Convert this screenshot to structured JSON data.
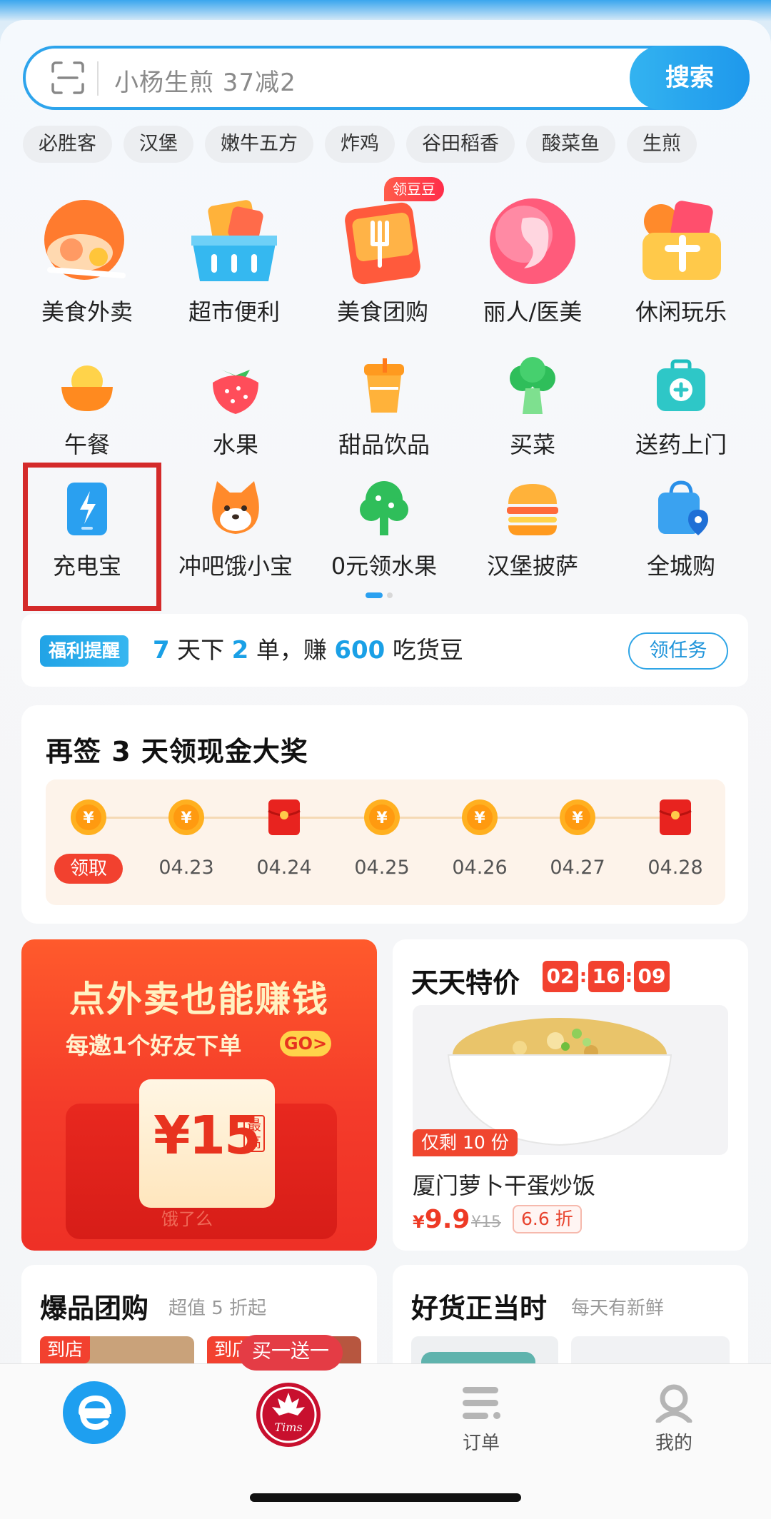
{
  "search": {
    "placeholder": "小杨生煎 37减2",
    "button_label": "搜索"
  },
  "hot_tags": [
    "必胜客",
    "汉堡",
    "嫩牛五方",
    "炸鸡",
    "谷田稻香",
    "酸菜鱼",
    "生煎"
  ],
  "main_categories": [
    {
      "label": "美食外卖",
      "icon": "food-delivery-icon"
    },
    {
      "label": "超市便利",
      "icon": "supermarket-basket-icon"
    },
    {
      "label": "美食团购",
      "icon": "group-buy-icon",
      "badge": "领豆豆"
    },
    {
      "label": "丽人/医美",
      "icon": "beauty-icon"
    },
    {
      "label": "休闲玩乐",
      "icon": "leisure-icon"
    }
  ],
  "row2": [
    {
      "label": "午餐",
      "icon": "rice-bowl-icon"
    },
    {
      "label": "水果",
      "icon": "strawberry-icon"
    },
    {
      "label": "甜品饮品",
      "icon": "drink-cup-icon"
    },
    {
      "label": "买菜",
      "icon": "broccoli-icon"
    },
    {
      "label": "送药上门",
      "icon": "medicine-kit-icon"
    }
  ],
  "row3": [
    {
      "label": "充电宝",
      "icon": "power-bank-icon"
    },
    {
      "label": "冲吧饿小宝",
      "icon": "shiba-dog-icon"
    },
    {
      "label": "0元领水果",
      "icon": "tree-icon"
    },
    {
      "label": "汉堡披萨",
      "icon": "burger-icon"
    },
    {
      "label": "全城购",
      "icon": "shopping-bag-location-icon"
    }
  ],
  "welfare": {
    "tag": "福利提醒",
    "n1": "7",
    "t1": "天下",
    "n2": "2",
    "t2": "单，赚",
    "n3": "600",
    "t3": "吃货豆",
    "button": "领任务"
  },
  "signin": {
    "title": "再签 3 天领现金大奖",
    "days": [
      {
        "label": "领取",
        "type": "coin",
        "active": true
      },
      {
        "label": "04.23",
        "type": "coin"
      },
      {
        "label": "04.24",
        "type": "redpacket"
      },
      {
        "label": "04.25",
        "type": "coin"
      },
      {
        "label": "04.26",
        "type": "coin"
      },
      {
        "label": "04.27",
        "type": "coin"
      },
      {
        "label": "04.28",
        "type": "redpacket"
      }
    ]
  },
  "promo": {
    "title": "点外卖也能赚钱",
    "subtitle": "每邀1个好友下单",
    "go": "GO>",
    "amount": "¥15",
    "max_label": "最高",
    "brand": "饿了么"
  },
  "deal": {
    "title": "天天特价",
    "timer": [
      "02",
      "16",
      "09"
    ],
    "remain": "仅剩 10 份",
    "name": "厦门萝卜干蛋炒饭",
    "price_symbol": "¥",
    "price": "9.9",
    "old_price": "¥15",
    "discount": "6.6 折"
  },
  "group_buy": {
    "title": "爆品团购",
    "subtitle": "超值 5 折起",
    "tag1": "到店",
    "tag2": "到店"
  },
  "goods": {
    "title": "好货正当时",
    "subtitle": "每天有新鲜"
  },
  "nav": {
    "bogo": "买一送一",
    "home": "",
    "tims": "Tims",
    "orders": "订单",
    "mine": "我的"
  },
  "colors": {
    "accent": "#1e98ec",
    "promo_red": "#f43b2a",
    "highlight_box": "#d42a2a"
  }
}
